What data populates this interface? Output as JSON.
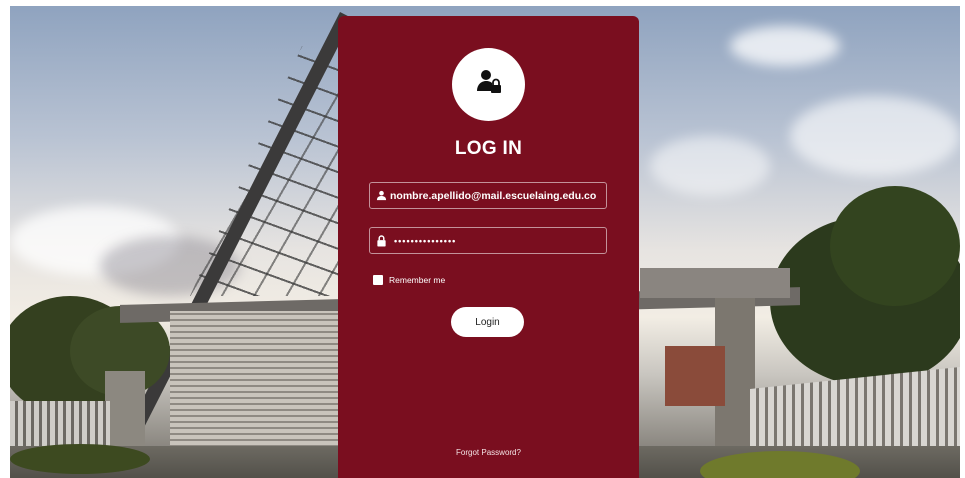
{
  "login": {
    "title": "LOG IN",
    "email_value": "nombre.apellido@mail.escuelaing.edu.co",
    "password_value": "•••••••••••••••",
    "remember_label": "Remember me",
    "login_button": "Login",
    "forgot_link": "Forgot Password?"
  },
  "icons": {
    "avatar": "user-lock-icon",
    "email": "user-icon",
    "password": "lock-icon"
  },
  "colors": {
    "panel": "#7a0e1f",
    "button": "#ffffff",
    "text": "#ffffff"
  }
}
